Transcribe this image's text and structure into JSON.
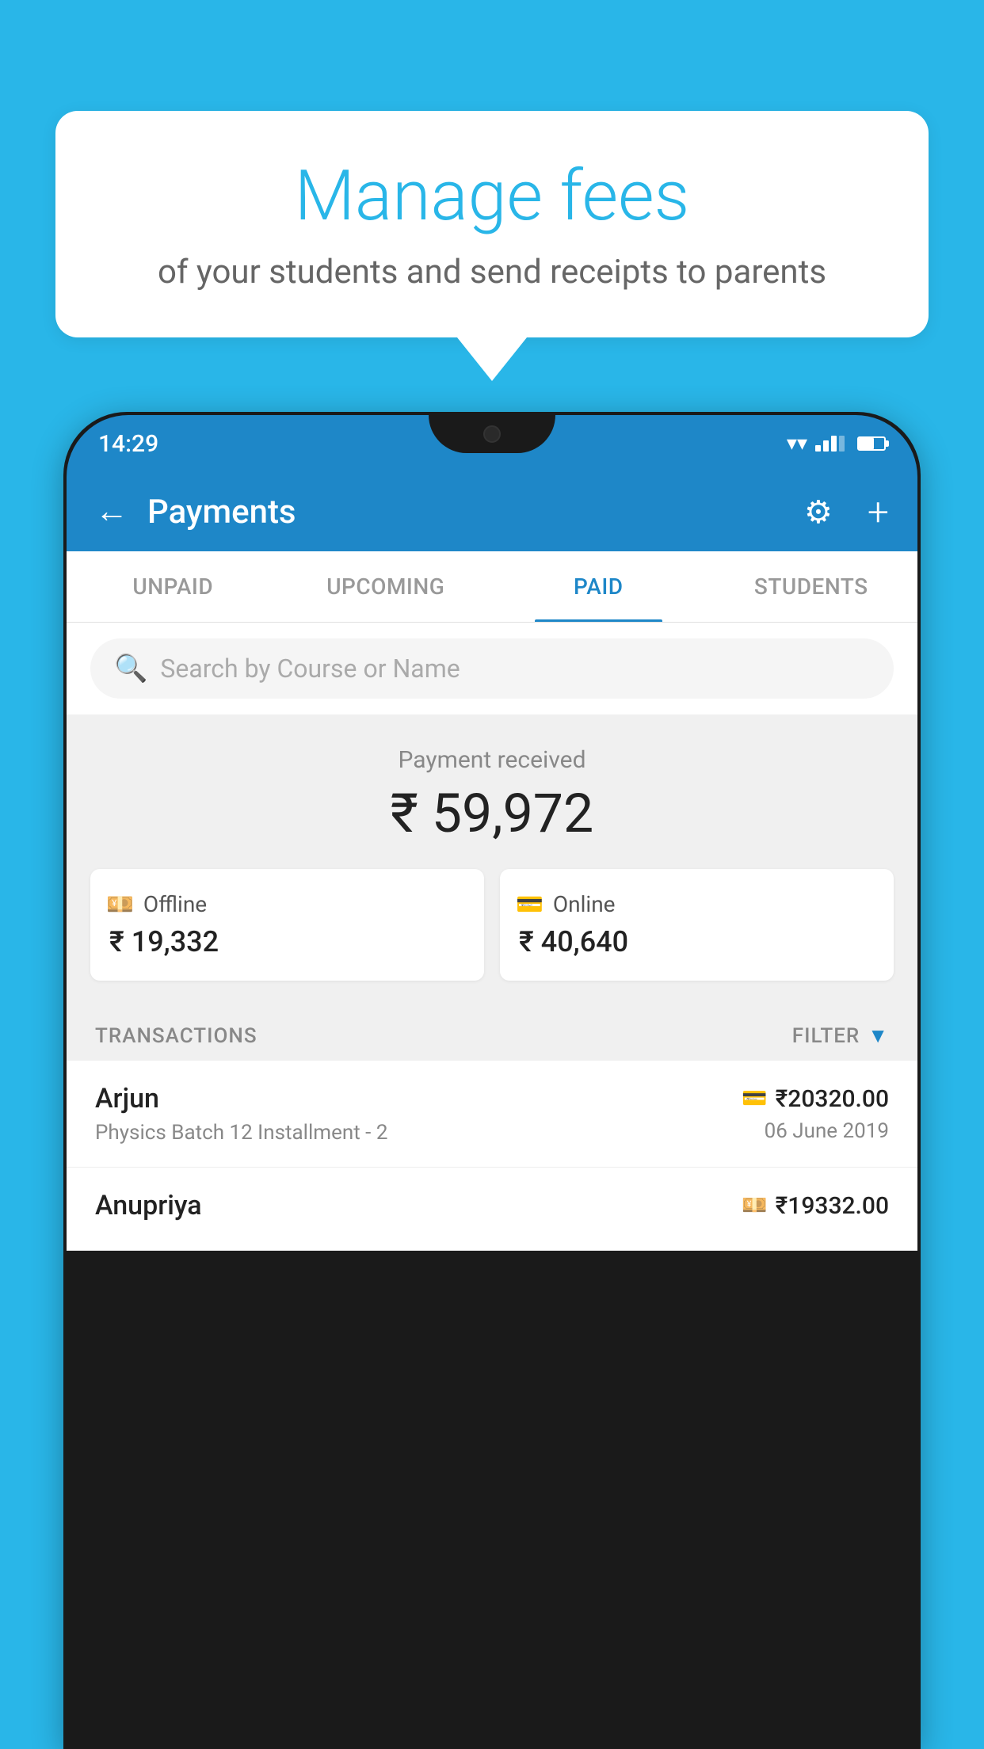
{
  "background_color": "#29b6e8",
  "speech_bubble": {
    "title": "Manage fees",
    "subtitle": "of your students and send receipts to parents"
  },
  "status_bar": {
    "time": "14:29"
  },
  "header": {
    "title": "Payments",
    "back_label": "←",
    "gear_label": "⚙",
    "plus_label": "+"
  },
  "tabs": [
    {
      "id": "unpaid",
      "label": "UNPAID",
      "active": false
    },
    {
      "id": "upcoming",
      "label": "UPCOMING",
      "active": false
    },
    {
      "id": "paid",
      "label": "PAID",
      "active": true
    },
    {
      "id": "students",
      "label": "STUDENTS",
      "active": false
    }
  ],
  "search": {
    "placeholder": "Search by Course or Name"
  },
  "payment_summary": {
    "label": "Payment received",
    "total": "₹ 59,972",
    "offline": {
      "label": "Offline",
      "amount": "₹ 19,332"
    },
    "online": {
      "label": "Online",
      "amount": "₹ 40,640"
    }
  },
  "transactions": {
    "label": "TRANSACTIONS",
    "filter_label": "FILTER",
    "items": [
      {
        "name": "Arjun",
        "detail": "Physics Batch 12 Installment - 2",
        "payment_method": "card",
        "amount": "₹20320.00",
        "date": "06 June 2019"
      },
      {
        "name": "Anupriya",
        "detail": "",
        "payment_method": "offline",
        "amount": "₹19332.00",
        "date": ""
      }
    ]
  }
}
